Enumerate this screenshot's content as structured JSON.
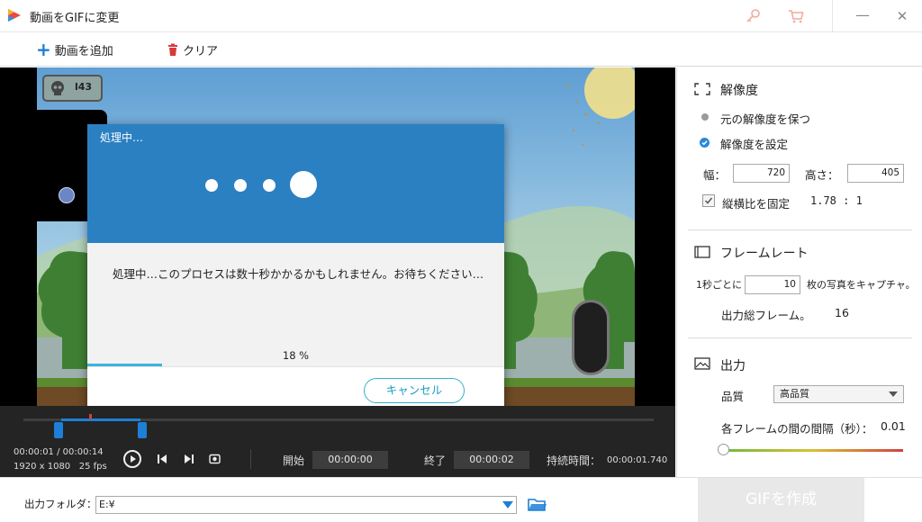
{
  "app": {
    "title": "動画をGIFに変更"
  },
  "toolbar": {
    "add_video": "動画を追加",
    "clear": "クリア"
  },
  "game": {
    "skull_count": "l43"
  },
  "dialog": {
    "title": "処理中…",
    "message": "処理中…このプロセスは数十秒かかるかもしれません。お待ちください…",
    "progress_text": "18 %",
    "progress": 0.18,
    "cancel": "キャンセル"
  },
  "player": {
    "time_current": "00:00:01",
    "time_total": "00:00:14",
    "time_separator": "/",
    "resolution": "1920 x 1080",
    "fps": "25 fps",
    "start_label": "開始",
    "start_value": "00:00:00",
    "end_label": "終了",
    "end_value": "00:00:02",
    "duration_label": "持続時間：",
    "duration_value": "00:00:01.740"
  },
  "settings": {
    "resolution": {
      "title": "解像度",
      "keep_original": "元の解像度を保つ",
      "set_resolution": "解像度を設定",
      "width_label": "幅：",
      "width_value": "720",
      "height_label": "高さ：",
      "height_value": "405",
      "aspect_lock": "縦横比を固定",
      "aspect_value": "1.78 : 1"
    },
    "framerate": {
      "title": "フレームレート",
      "per_second": "1秒ごとに",
      "fps_value": "10",
      "capture_text": "枚の写真をキャプチャ。",
      "total_frames_label": "出力総フレーム。",
      "total_frames_value": "16"
    },
    "output": {
      "title": "出力",
      "quality_label": "品質",
      "quality_value": "高品質",
      "interval_label": "各フレームの間の間隔（秒）：",
      "interval_value": "0.01"
    }
  },
  "bottom": {
    "output_folder_label": "出力フォルダ：",
    "output_folder_value": "E:¥",
    "create_gif": "GIFを作成"
  },
  "colors": {
    "accent": "#2b80c2",
    "progress": "#3cb4e0",
    "cancel_border": "#36b0cc"
  }
}
